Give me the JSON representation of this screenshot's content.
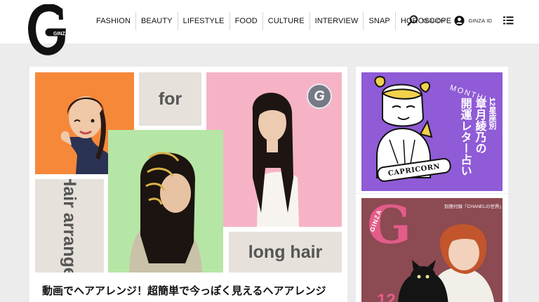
{
  "header": {
    "logo_text": "GINZA",
    "nav": [
      "FASHION",
      "BEAUTY",
      "LIFESTYLE",
      "FOOD",
      "CULTURE",
      "INTERVIEW",
      "SNAP",
      "HOROSCOPE"
    ],
    "search_label": "SEARCH",
    "ginza_id_label": "GINZA ID",
    "menu_icon": "hamburger-menu-icon"
  },
  "feature": {
    "word_for": "for",
    "word_hair_arrange": "Hair arrange",
    "word_long_hair": "long hair",
    "badge": "G",
    "headline": "動画でヘアアレンジ！超簡単で今っぽく見えるヘアアレンジ"
  },
  "horoscope": {
    "monthly": "MONTHLY",
    "col1": "12星座別",
    "col2": "章月綾乃の",
    "col3": "開運レター占い",
    "ribbon": "CAPRICORN"
  },
  "magazine": {
    "logo": "G",
    "logo_text": "GINZA",
    "supplement": "別冊付録『CHANELの世界』",
    "issue": "12"
  },
  "colors": {
    "orange": "#f6883a",
    "pink": "#f6b3c6",
    "green": "#b6e6a6",
    "beige": "#e6e1da",
    "purple": "#8f5bd6",
    "magazine": "#8c4a52",
    "magazine_pink": "#e35c8a"
  }
}
